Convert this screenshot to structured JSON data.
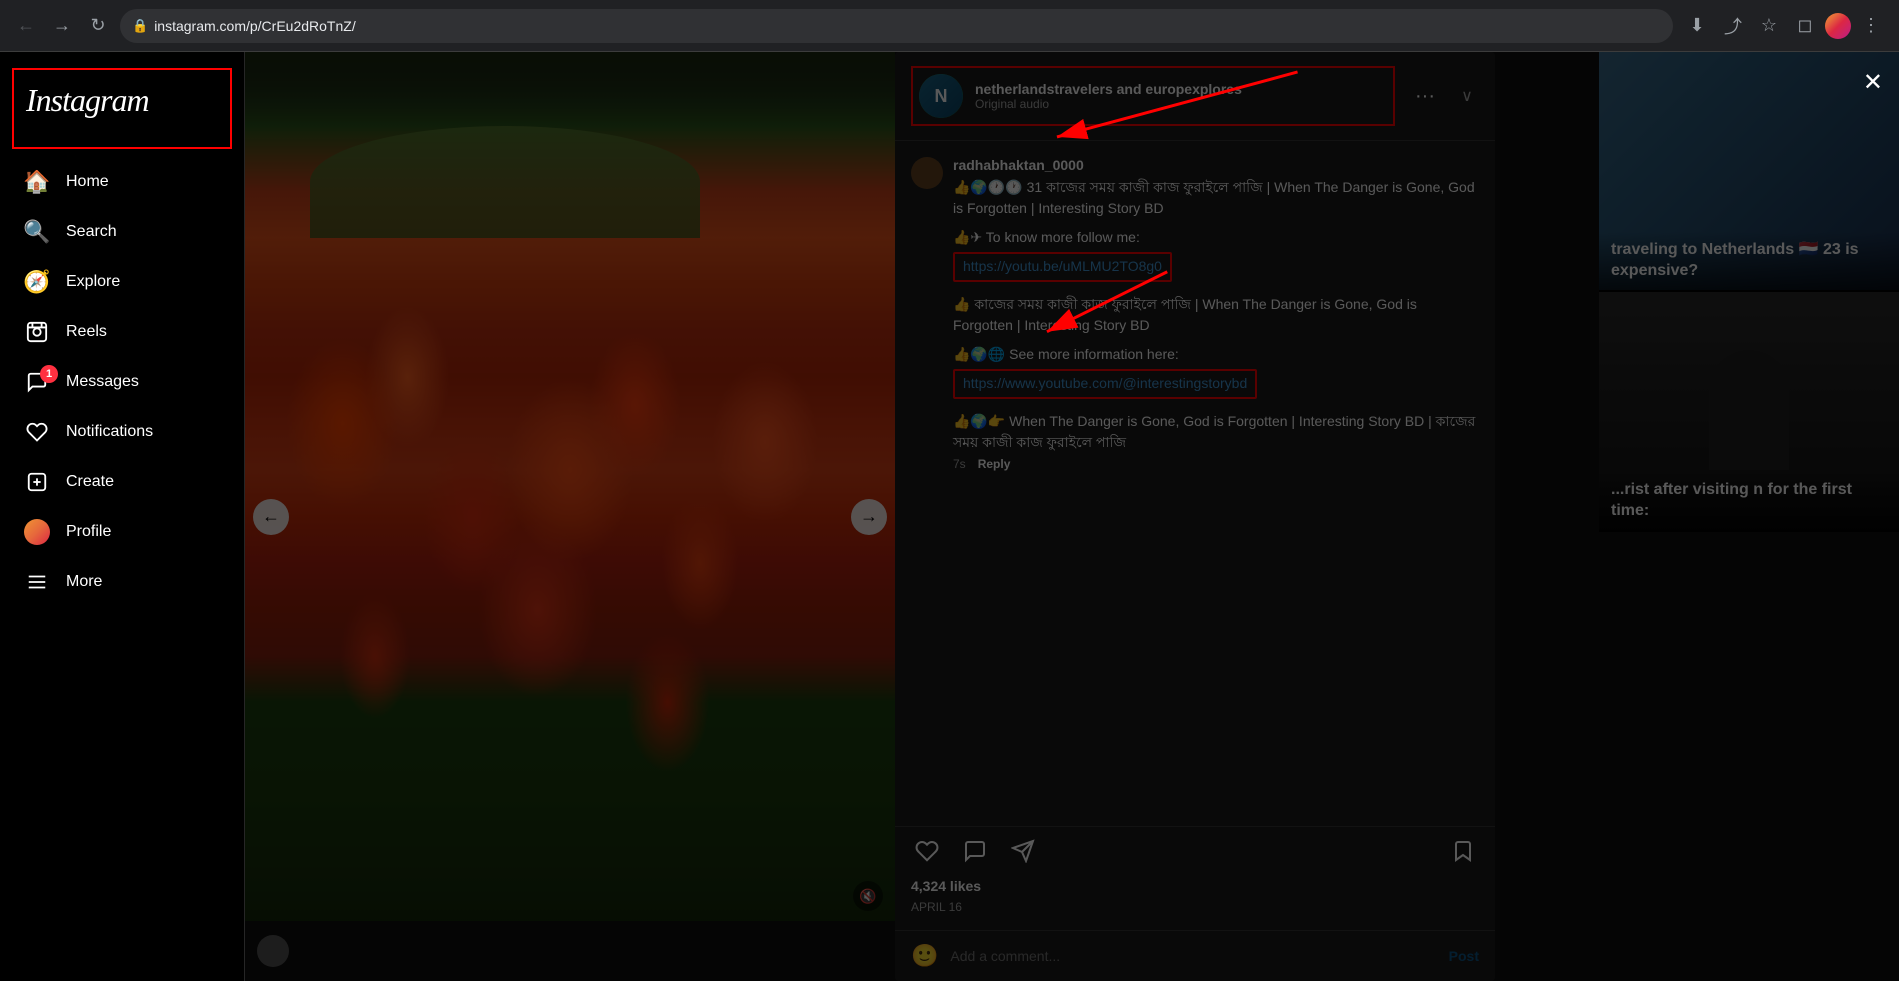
{
  "browser": {
    "url": "instagram.com/p/CrEu2dRoTnZ/",
    "back_disabled": false,
    "forward_disabled": false
  },
  "app": {
    "title": "Instagram"
  },
  "sidebar": {
    "logo": "Instagram",
    "nav_items": [
      {
        "id": "home",
        "label": "Home",
        "icon": "🏠"
      },
      {
        "id": "search",
        "label": "Search",
        "icon": "🔍"
      },
      {
        "id": "explore",
        "label": "Explore",
        "icon": "🧭"
      },
      {
        "id": "reels",
        "label": "Reels",
        "icon": "🎬"
      },
      {
        "id": "messages",
        "label": "Messages",
        "icon": "✉️",
        "badge": "1"
      },
      {
        "id": "notifications",
        "label": "Notifications",
        "icon": "♡"
      },
      {
        "id": "create",
        "label": "Create",
        "icon": "⊕"
      },
      {
        "id": "profile",
        "label": "Profile",
        "icon": "👤"
      },
      {
        "id": "more",
        "label": "More",
        "icon": "☰"
      }
    ]
  },
  "post": {
    "username_main": "netherlandstravelers",
    "username_tag": "europexplores",
    "username_display": "netherlandstravelers and europexplores",
    "audio_label": "Original audio",
    "more_options_label": "···",
    "comments": [
      {
        "id": "c1",
        "username": "radhabhaktan_0000",
        "text": "👍🌍🕐🕐 31 কাজের সময় কাজী কাজ ফুরাইলে পাজি | When The Danger is Gone, God is Forgotten | Interesting Story BD",
        "follow_text": "👍✈ To know more follow me:",
        "link1": "https://youtu.be/uMLMU2TO8g0",
        "extra_text": "👍 কাজের সময় কাজী কাজ ফুরাইলে পাজি | When The Danger is Gone, God is Forgotten | Interesting Story BD",
        "see_more_text": "👍🌍🌐 See more information here:",
        "link2": "https://www.youtube.com/@interestingstorybd",
        "final_text": "👍🌍👉 When The Danger is Gone, God is Forgotten | Interesting Story BD | কাজের সময় কাজী কাজ ফুরাইলে পাজি",
        "time_ago": "7s",
        "reply_label": "Reply"
      }
    ],
    "likes_count": "4,324 likes",
    "post_date": "April 16",
    "add_comment_placeholder": "Add a comment...",
    "post_button_label": "Post",
    "close_label": "✕"
  },
  "side_content": [
    {
      "title": "traveling to Netherlands 🇳🇱 23 is expensive?",
      "bg_color": "#2a4a6a"
    },
    {
      "title": "...rist after visiting n for the first time:",
      "bg_color": "#1a1a1a"
    }
  ]
}
